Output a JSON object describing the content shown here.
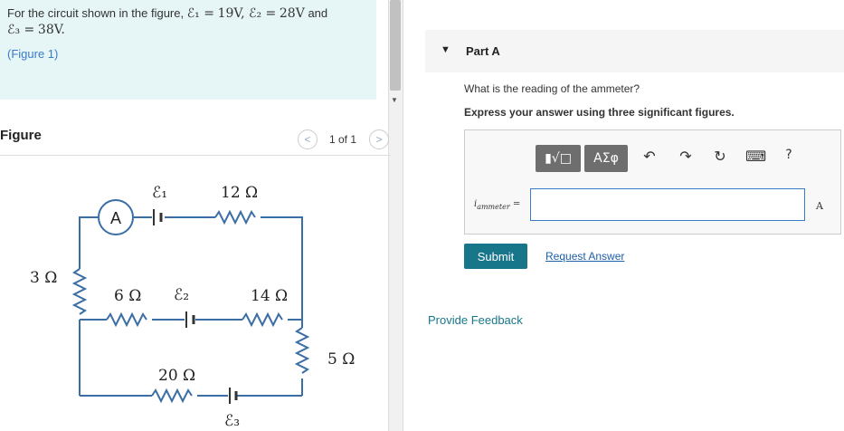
{
  "problem": {
    "text_prefix": "For the circuit shown in the figure, ",
    "e1_symbol": "ℰ₁ =",
    "e1_value": "19V",
    "e2_symbol": ", ℰ₂ =",
    "e2_value": "28V",
    "and_word": " and",
    "e3_symbol": "ℰ₃ =",
    "e3_value": "38V.",
    "figure_link": "(Figure 1)"
  },
  "figure": {
    "title": "Figure",
    "pager": "1 of 1",
    "prev_icon": "chevron-left-icon",
    "next_icon": "chevron-right-icon",
    "labels": {
      "e1": "ℰ₁",
      "r12": "12 Ω",
      "ammeter": "A",
      "r3": "3 Ω",
      "r6": "6 Ω",
      "e2": "ℰ₂",
      "r14": "14 Ω",
      "r5": "5 Ω",
      "r20": "20 Ω",
      "e3": "ℰ₃"
    }
  },
  "part": {
    "arrow_icon": "triangle-down-icon",
    "title": "Part A",
    "question": "What is the reading of the ammeter?",
    "instruction": "Express your answer using three significant figures.",
    "toolbar": {
      "templates_label": "▮√□",
      "symbols_label": "ΑΣφ",
      "undo_icon": "↶",
      "redo_icon": "↷",
      "reset_icon": "↻",
      "keyboard_icon": "⌨",
      "help_label": "?"
    },
    "answer_label": "i",
    "answer_sub": "ammeter",
    "answer_eq": " =",
    "answer_value": "",
    "unit": "A",
    "submit_label": "Submit",
    "request_label": "Request Answer",
    "feedback_label": "Provide Feedback"
  },
  "colors": {
    "problem_bg": "#e6f5f6",
    "submit_bg": "#17768a",
    "link": "#1f5fa8"
  }
}
